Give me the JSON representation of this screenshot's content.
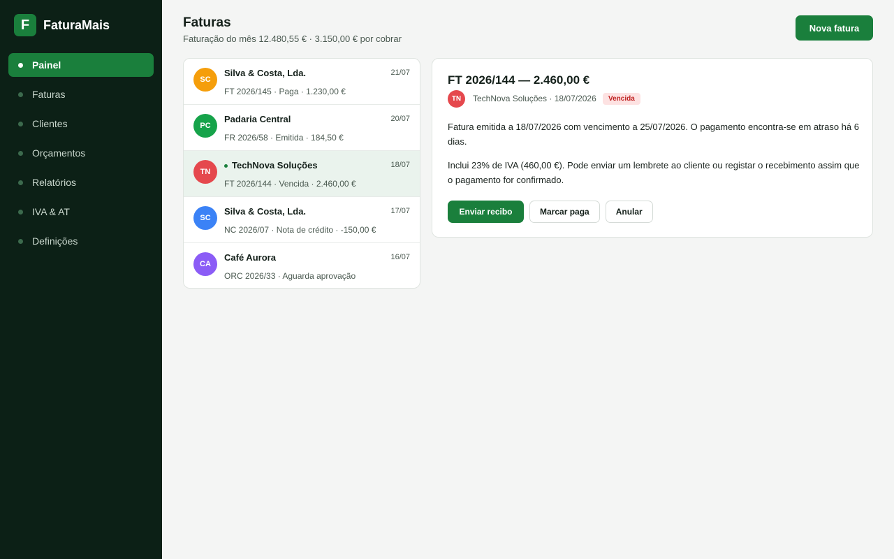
{
  "app": {
    "name": "FaturaMais",
    "logo_letter": "F"
  },
  "sidebar": {
    "items": [
      {
        "label": "Painel",
        "active": true
      },
      {
        "label": "Faturas",
        "active": false
      },
      {
        "label": "Clientes",
        "active": false
      },
      {
        "label": "Orçamentos",
        "active": false
      },
      {
        "label": "Relatórios",
        "active": false
      },
      {
        "label": "IVA & AT",
        "active": false
      },
      {
        "label": "Definições",
        "active": false
      }
    ]
  },
  "header": {
    "title": "Faturas",
    "subtitle": "Faturação do mês 12.480,55 € · 3.150,00 € por cobrar",
    "new_button_label": "Nova fatura"
  },
  "invoices": [
    {
      "initials": "SC",
      "avatar_color": "#f59e0b",
      "name": "Silva & Costa, Lda.",
      "meta": "FT 2026/145 · Paga · 1.230,00 €",
      "date": "21/07",
      "selected": false
    },
    {
      "initials": "PC",
      "avatar_color": "#16a34a",
      "name": "Padaria Central",
      "meta": "FR 2026/58 · Emitida · 184,50 €",
      "date": "20/07",
      "selected": false
    },
    {
      "initials": "TN",
      "avatar_color": "#e5484d",
      "name": "TechNova Soluções",
      "meta": "FT 2026/144 · Vencida · 2.460,00 €",
      "date": "18/07",
      "selected": true
    },
    {
      "initials": "SC",
      "avatar_color": "#3b82f6",
      "name": "Silva & Costa, Lda.",
      "meta": "NC 2026/07 · Nota de crédito · -150,00 €",
      "date": "17/07",
      "selected": false
    },
    {
      "initials": "CA",
      "avatar_color": "#8b5cf6",
      "name": "Café Aurora",
      "meta": "ORC 2026/33 · Aguarda aprovação",
      "date": "16/07",
      "selected": false
    }
  ],
  "detail": {
    "title": "FT 2026/144 — 2.460,00 €",
    "avatar_initials": "TN",
    "client_line": "TechNova Soluções · 18/07/2026",
    "status_badge": "Vencida",
    "paragraph1": "Fatura emitida a 18/07/2026 com vencimento a 25/07/2026. O pagamento encontra-se em atraso há 6 dias.",
    "paragraph2": "Inclui 23% de IVA (460,00 €). Pode enviar um lembrete ao cliente ou registar o recebimento assim que o pagamento for confirmado.",
    "actions": {
      "send_receipt": "Enviar recibo",
      "mark_paid": "Marcar paga",
      "cancel": "Anular"
    }
  },
  "colors": {
    "brand": "#1a7f3c",
    "sidebar_bg": "#0c2016",
    "overdue": "#c02323"
  }
}
